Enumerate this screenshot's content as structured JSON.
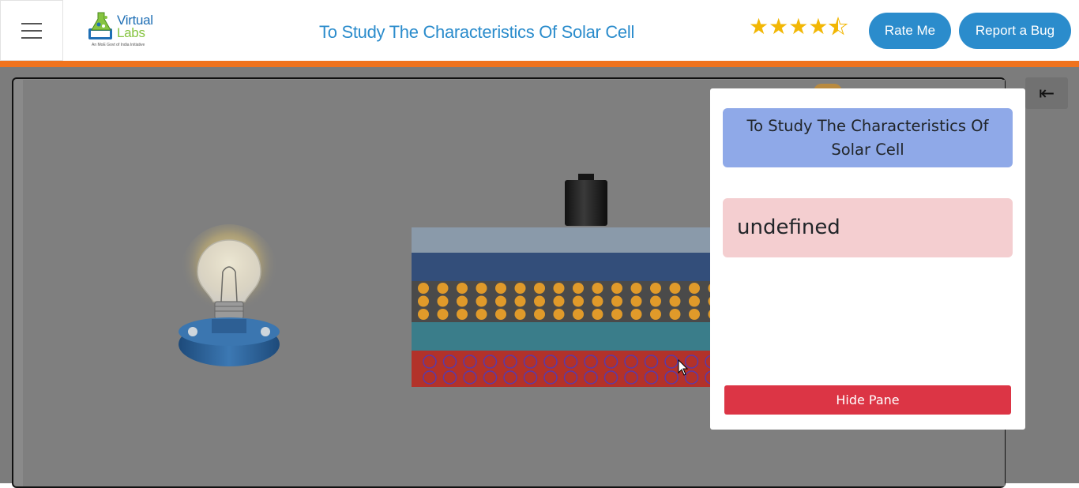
{
  "header": {
    "logo": {
      "line1": "Virtual",
      "line2": "Labs",
      "tagline": "An MoE Govt of India Initiative"
    },
    "title": "To Study The Characteristics Of Solar Cell",
    "rating": {
      "value": 4.5,
      "max": 5
    },
    "rate_button": "Rate Me",
    "bug_button": "Report a Bug"
  },
  "colors": {
    "brand_blue": "#2b8ccc",
    "accent_orange": "#f0731e",
    "danger": "#dc3545"
  },
  "simulation": {
    "icons": [
      "light-bulb-icon",
      "battery-icon",
      "solar-cell-icon"
    ],
    "collapse_icon": "arrow-left-bar-icon"
  },
  "pane": {
    "title": "To Study The Characteristics Of Solar Cell",
    "message": "undefined",
    "hide_button": "Hide Pane"
  }
}
